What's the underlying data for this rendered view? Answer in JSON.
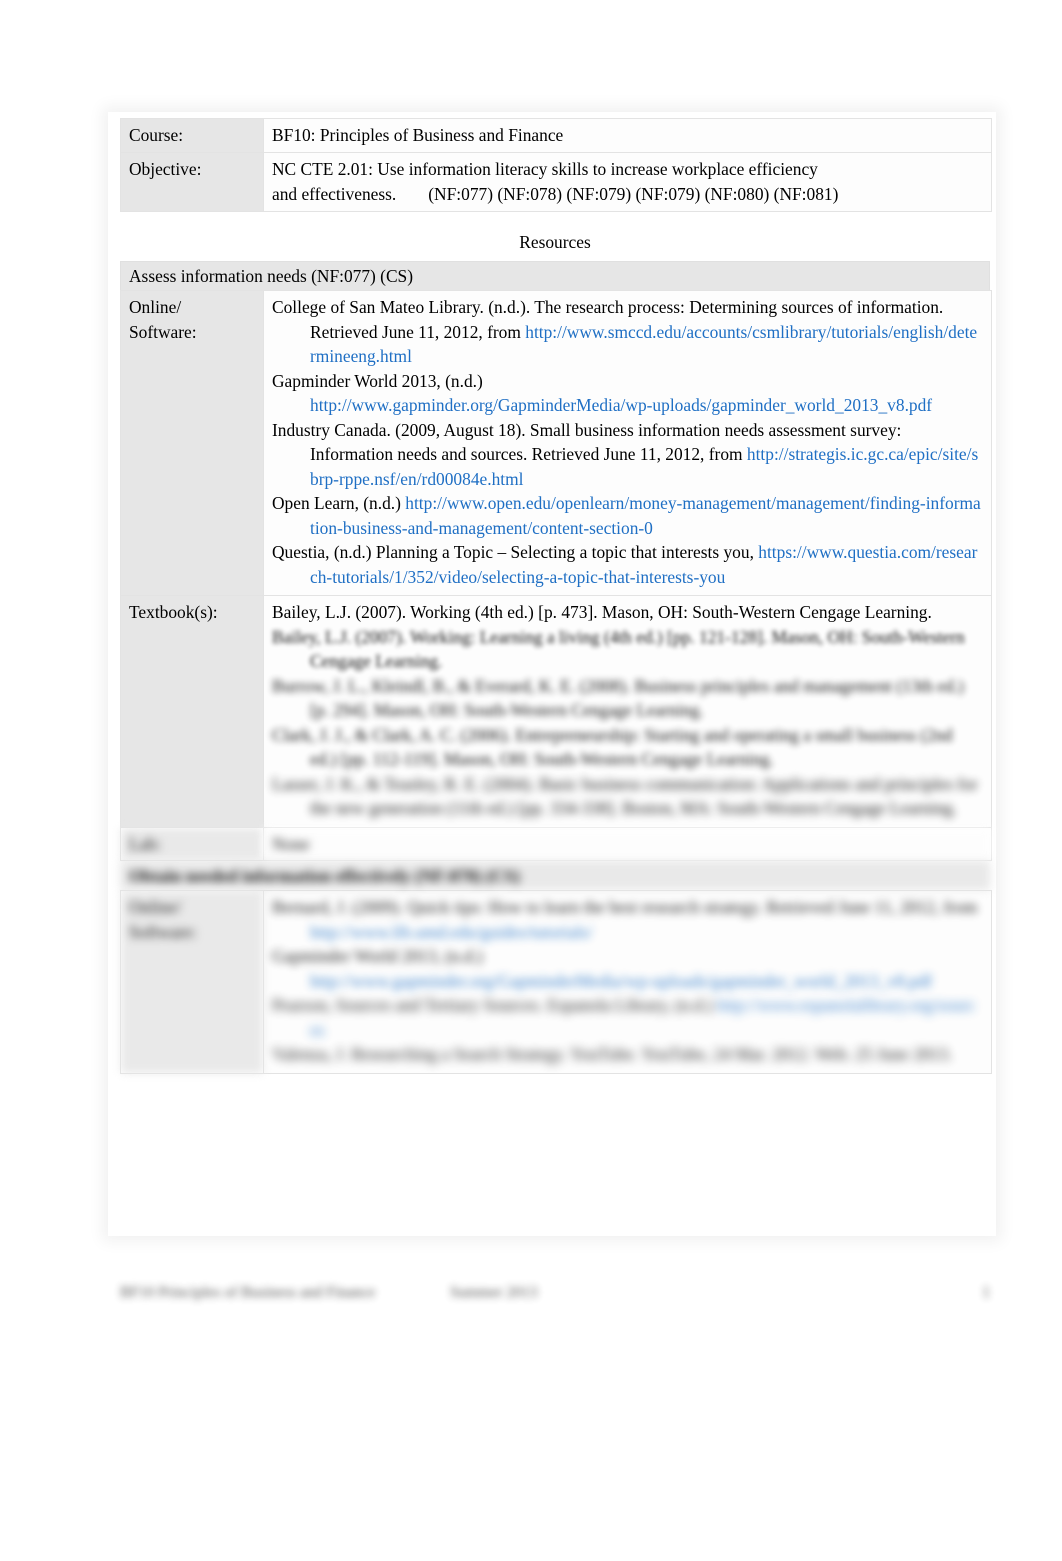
{
  "document": {
    "header": {
      "rows": [
        {
          "label": "Course:",
          "value": "BF10: Principles of Business and Finance"
        },
        {
          "label": "Objective:",
          "value_line1": "NC CTE 2.01: Use information literacy skills to increase workplace efficiency",
          "value_line2a": "and effectiveness.",
          "value_line2b": "(NF:077) (NF:078) (NF:079) (NF:079) (NF:080) (NF:081)"
        }
      ]
    },
    "resources_title": "Resources",
    "section_1": {
      "band": "Assess information needs (NF:077) (CS)",
      "online_label_line1": "Online/",
      "online_label_line2": "Software:",
      "citations": [
        {
          "text_before": "College of San Mateo Library. (n.d.). The research process: Determining sources of information. Retrieved June 11, 2012, from ",
          "link": "http://www.smccd.edu/accounts/csmlibrary/tutorials/english/determineeng.html",
          "text_after": ""
        },
        {
          "text_before": "Gapminder World 2013, (n.d.) ",
          "link": "http://www.gapminder.org/GapminderMedia/wp-uploads/gapminder_world_2013_v8.pdf",
          "text_after": ""
        },
        {
          "text_before": "Industry Canada. (2009, August 18). Small business information needs assessment survey: Information needs and sources. Retrieved June 11, 2012, from  ",
          "link": "http://strategis.ic.gc.ca/epic/site/sbrp-rppe.nsf/en/rd00084e.html",
          "text_after": ""
        },
        {
          "text_before": "Open Learn, (n.d.)   ",
          "link": "http://www.open.edu/openlearn/money-management/management/finding-information-business-and-management/content-section-0",
          "text_after": ""
        },
        {
          "text_before": "Questia, (n.d.) Planning a Topic – Selecting a topic that interests you, ",
          "link": "https://www.questia.com/research-tutorials/1/352/video/selecting-a-topic-that-interests-you",
          "text_after": ""
        }
      ],
      "textbook_label": "Textbook(s):",
      "textbook_citations": [
        "Bailey, L.J. (2007). Working (4th ed.) [p. 473]. Mason, OH: South-Western Cengage Learning."
      ],
      "textbook_redacted_lines": [
        "Bailey, L.J. (2007). Working: Learning a living (4th ed.) [pp. 121-128]. Mason, OH: South-Western Cengage Learning.",
        "Burrow, J. L., Kleindl, B., & Everard, K. E. (2008). Business principles and management (13th ed.) [p. 294]. Mason, OH: South-Western Cengage Learning.",
        "Clark, J. J., & Clark, A. C. (2006). Entrepreneurship: Starting and operating a small business (2nd ed.) [pp. 112-119]. Mason, OH: South-Western Cengage Learning.",
        "Lasser, J. K., & Teasley, R. E. (2004). Basic business communication: Applications and principles for the new generation (11th ed.) [pp. 334-338]. Boston, MA: South-Western Cengage Learning."
      ],
      "trailing_label": "Lab:",
      "trailing_value": "None"
    },
    "section_2": {
      "band": "Obtain needed information effectively (NF:078) (CS)",
      "online_label_line1": "Online/",
      "online_label_line2": "Software:",
      "citations_redacted": [
        {
          "text_before": "Bernard, J. (2009). Quick tips: How to learn the best research strategy. Retrieved June 11, 2012, from ",
          "link": "http://www.lib.umd.edu/guides/tutorials/"
        },
        {
          "text_before": "Gapminder World 2013, (n.d.) ",
          "link": "http://www.gapminder.org/GapminderMedia/wp-uploads/gapminder_world_2013_v8.pdf"
        },
        {
          "text_before": "Pearson, Sources and Tertiary Sources. Espanola Library, (n.d.) ",
          "link": "http://www.espanolalibrary.org/sources"
        },
        {
          "text_before": "Valenza, J. Researching a Search Strategy. YouTube. YouTube, 24 Mar. 2012. Web. 25 June 2013.",
          "link": ""
        }
      ]
    },
    "footer": {
      "left": "BF10 Principles of Business and Finance",
      "middle": "Summer 2013",
      "right": "1"
    }
  }
}
